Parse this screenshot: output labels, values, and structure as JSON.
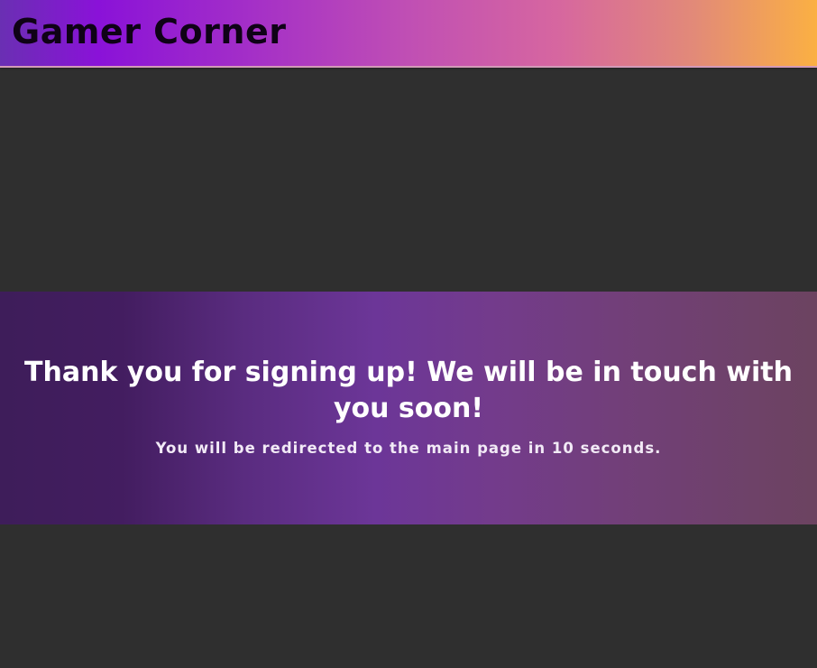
{
  "header": {
    "site_title": "Gamer Corner"
  },
  "confirmation": {
    "headline": "Thank you for signing up! We will be in touch with you soon!",
    "redirect_notice": "You will be redirected to the main page in 10 seconds."
  },
  "colors": {
    "page_background": "#2f2f2f",
    "header_gradient": [
      "#8a12d8",
      "#c04fb4",
      "#fbb043"
    ],
    "banner_gradient": [
      "#431d60",
      "#6c3698",
      "#6c4360"
    ],
    "title_text": "#0f0216",
    "banner_text": "#ffffff"
  }
}
